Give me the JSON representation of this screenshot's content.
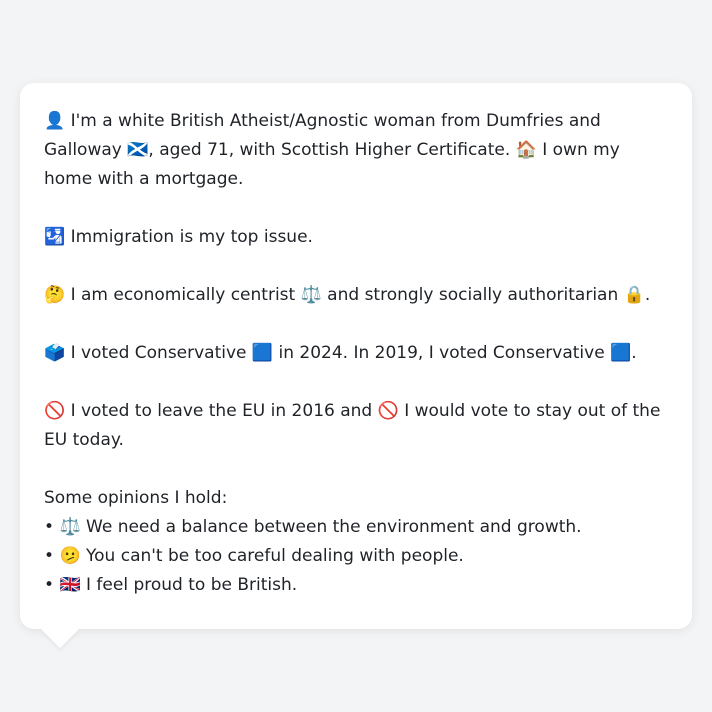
{
  "profile": {
    "intro_icon": "👤",
    "intro_text_1": " I'm a white British Atheist/Agnostic woman from Dumfries and Galloway ",
    "flag_icon": "🏴󠁧󠁢󠁳󠁣󠁴󠁿",
    "intro_text_2": ", aged 71, with Scottish Higher Certificate. ",
    "home_icon": "🏠",
    "intro_text_3": " I own my home with a mortgage."
  },
  "issue": {
    "icon": "🛂",
    "text": " Immigration is my top issue."
  },
  "ideology": {
    "icon": "🤔",
    "text_1": " I am economically centrist ",
    "scales_icon": "⚖️",
    "text_2": " and strongly socially authoritarian ",
    "lock_icon": "🔒",
    "text_3": "."
  },
  "votes": {
    "icon": "🗳️",
    "text_1": " I voted Conservative ",
    "party_icon_1": "🟦",
    "text_2": " in 2024. In 2019, I voted Conservative ",
    "party_icon_2": "🟦",
    "text_3": "."
  },
  "eu": {
    "icon_1": "🚫",
    "text_1": " I voted to leave the EU in 2016 and ",
    "icon_2": "🚫",
    "text_2": " I would vote to stay out of the EU today."
  },
  "opinions": {
    "heading": "Some opinions I hold:",
    "bullet": "•",
    "items": [
      {
        "icon": "⚖️",
        "text": " We need a balance between the environment and growth."
      },
      {
        "icon": "🫤",
        "text": " You can't be too careful dealing with people."
      },
      {
        "icon": "🇬🇧",
        "text": " I feel proud to be British."
      }
    ]
  }
}
